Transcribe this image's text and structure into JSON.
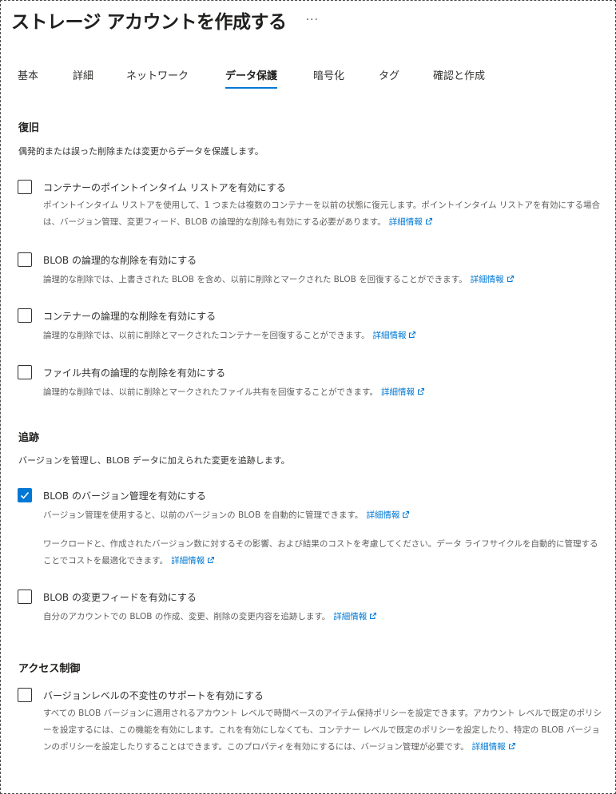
{
  "header": {
    "title": "ストレージ アカウントを作成する",
    "more": "···"
  },
  "tabs": [
    {
      "label": "基本"
    },
    {
      "label": "詳細"
    },
    {
      "label": "ネットワーク"
    },
    {
      "label": "データ保護"
    },
    {
      "label": "暗号化"
    },
    {
      "label": "タグ"
    },
    {
      "label": "確認と作成"
    }
  ],
  "active_tab": "データ保護",
  "link_text": "詳細情報",
  "recovery": {
    "title": "復旧",
    "desc": "偶発的または誤った削除または変更からデータを保護します。",
    "options": [
      {
        "label": "コンテナーのポイントインタイム リストアを有効にする",
        "checked": false,
        "desc": "ポイントインタイム リストアを使用して、1 つまたは複数のコンテナーを以前の状態に復元します。ポイントインタイム リストアを有効にする場合は、バージョン管理、変更フィード、BLOB の論理的な削除も有効にする必要があります。"
      },
      {
        "label": "BLOB の論理的な削除を有効にする",
        "checked": false,
        "desc": "論理的な削除では、上書きされた BLOB を含め、以前に削除とマークされた BLOB を回復することができます。"
      },
      {
        "label": "コンテナーの論理的な削除を有効にする",
        "checked": false,
        "desc": "論理的な削除では、以前に削除とマークされたコンテナーを回復することができます。"
      },
      {
        "label": "ファイル共有の論理的な削除を有効にする",
        "checked": false,
        "desc": "論理的な削除では、以前に削除とマークされたファイル共有を回復することができます。"
      }
    ]
  },
  "tracking": {
    "title": "追跡",
    "desc": "バージョンを管理し、BLOB データに加えられた変更を追跡します。",
    "options": [
      {
        "label": "BLOB のバージョン管理を有効にする",
        "checked": true,
        "desc": "バージョン管理を使用すると、以前のバージョンの BLOB を自動的に管理できます。",
        "desc2": "ワークロードと、作成されたバージョン数に対するその影響、および結果のコストを考慮してください。データ ライフサイクルを自動的に管理することでコストを最適化できます。"
      },
      {
        "label": "BLOB の変更フィードを有効にする",
        "checked": false,
        "desc": "自分のアカウントでの BLOB の作成、変更、削除の変更内容を追跡します。"
      }
    ]
  },
  "access": {
    "title": "アクセス制御",
    "options": [
      {
        "label": "バージョンレベルの不変性のサポートを有効にする",
        "checked": false,
        "desc": "すべての BLOB バージョンに適用されるアカウント レベルで時間ベースのアイテム保持ポリシーを設定できます。アカウント レベルで既定のポリシーを設定するには、この機能を有効にします。これを有効にしなくても、コンテナー レベルで既定のポリシーを設定したり、特定の BLOB バージョンのポリシーを設定したりすることはできます。このプロパティを有効にするには、バージョン管理が必要です。"
      }
    ]
  },
  "colors": {
    "accent": "#0078d4",
    "text": "#323130",
    "muted": "#605e5c"
  },
  "icons": {
    "external": "external-link-icon",
    "check": "checkmark-icon"
  }
}
